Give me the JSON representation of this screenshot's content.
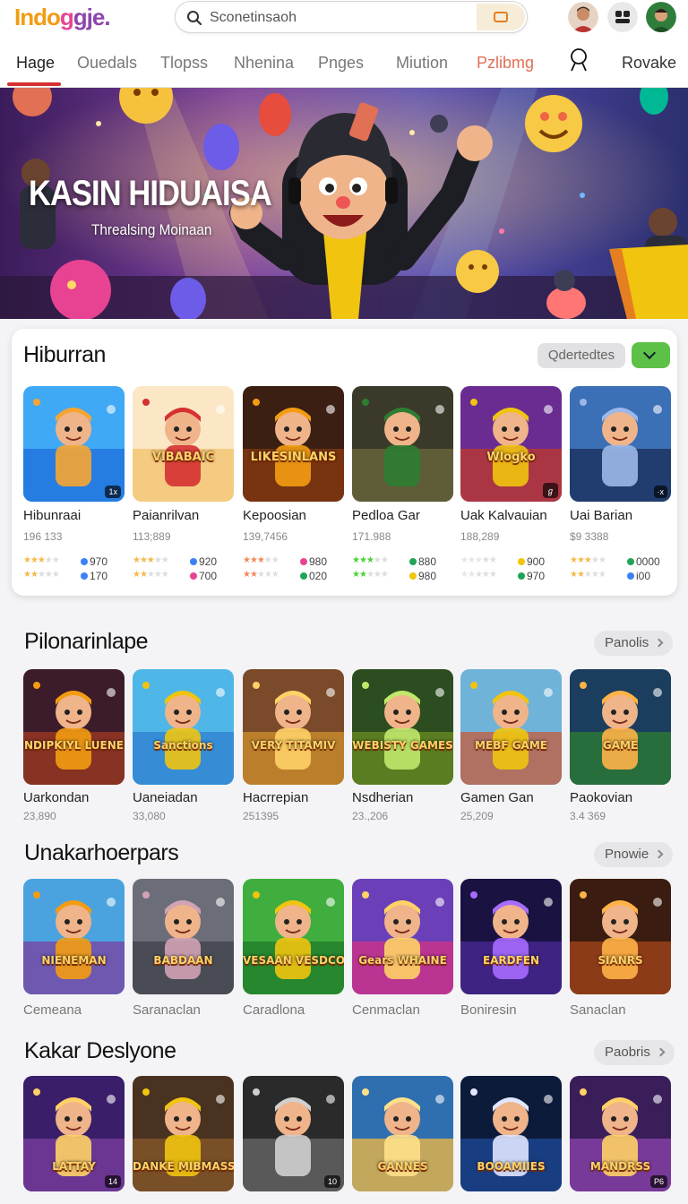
{
  "header": {
    "logo": [
      "Indo",
      "g",
      "gje."
    ],
    "search_placeholder": "Sconetinsaoh"
  },
  "nav": {
    "items": [
      "Hage",
      "Ouedals",
      "Tlopss",
      "Nhenina",
      "Pnges",
      "Miution",
      "Pzlibmg",
      "Rovake"
    ],
    "active": "Hage",
    "accent_item": "Pzlibmg"
  },
  "hero": {
    "title": "KASIN HIDUAISA",
    "subtitle": "Threalsing Moinaan"
  },
  "hiburran": {
    "title": "Hiburran",
    "sort_label": "Qdertedtes",
    "items": [
      {
        "name": "Hibunraai",
        "count": "196 133",
        "r1": "970",
        "r2": "170",
        "badge": "1x"
      },
      {
        "name": "Paianrilvan",
        "count": "113;889",
        "r1": "920",
        "r2": "700",
        "badge": ""
      },
      {
        "name": "Kepoosian",
        "count": "139,7456",
        "r1": "980",
        "r2": "020",
        "badge": ""
      },
      {
        "name": "Pedloa Gar",
        "count": "171.988",
        "r1": "880",
        "r2": "980",
        "badge": ""
      },
      {
        "name": "Uak Kalvauian",
        "count": "188,289",
        "r1": "900",
        "r2": "970",
        "badge": "ℊ"
      },
      {
        "name": "Uai Barian",
        "count": "$9 3388",
        "r1": "0000",
        "r2": "i00",
        "badge": "·x"
      }
    ],
    "tile_texts": [
      "",
      "VIBABAIC",
      "LIKESINLANS",
      "",
      "Wlogko",
      ""
    ]
  },
  "pilonarinlape": {
    "title": "Pilonarinlape",
    "more_label": "Panolis",
    "items": [
      {
        "name": "Uarkondan",
        "count": "23,890"
      },
      {
        "name": "Uaneiadan",
        "count": "33,080"
      },
      {
        "name": "Hacrrepian",
        "count": "251395"
      },
      {
        "name": "Nsdherian",
        "count": "23.,206"
      },
      {
        "name": "Gamen Gan",
        "count": "25,209"
      },
      {
        "name": "Paokovian",
        "count": "3.4 369"
      }
    ],
    "tile_texts": [
      "NDIPKIYL LUENE",
      "Sanctions",
      "VERY TITAMIV",
      "WEBISTY GAMES",
      "MEBF GAME",
      "GAME"
    ]
  },
  "unakar": {
    "title": "Unakarhoerpars",
    "more_label": "Pnowie",
    "items": [
      "Cemeana",
      "Saranaclan",
      "Caradlona",
      "Cenmaclan",
      "Boniresin",
      "Sanaclan"
    ],
    "tile_texts": [
      "NIENEMAN",
      "BABDAAN",
      "VESAAN VESDCOS",
      "Gears WHAINE",
      "EARDFEN",
      "SIANRS"
    ]
  },
  "kakar": {
    "title": "Kakar Deslyone",
    "more_label": "Paobris",
    "tile_texts": [
      "LATTAY",
      "DANKE MIBMASS",
      "",
      "GANNES",
      "BOOAMIIES",
      "MANDRSS"
    ],
    "badges": [
      "14",
      "",
      "10",
      "",
      "",
      "P6"
    ]
  },
  "colors": {
    "accent_red": "#d63031",
    "green_button": "#5cc146",
    "search_button": "#f6ecd8"
  }
}
